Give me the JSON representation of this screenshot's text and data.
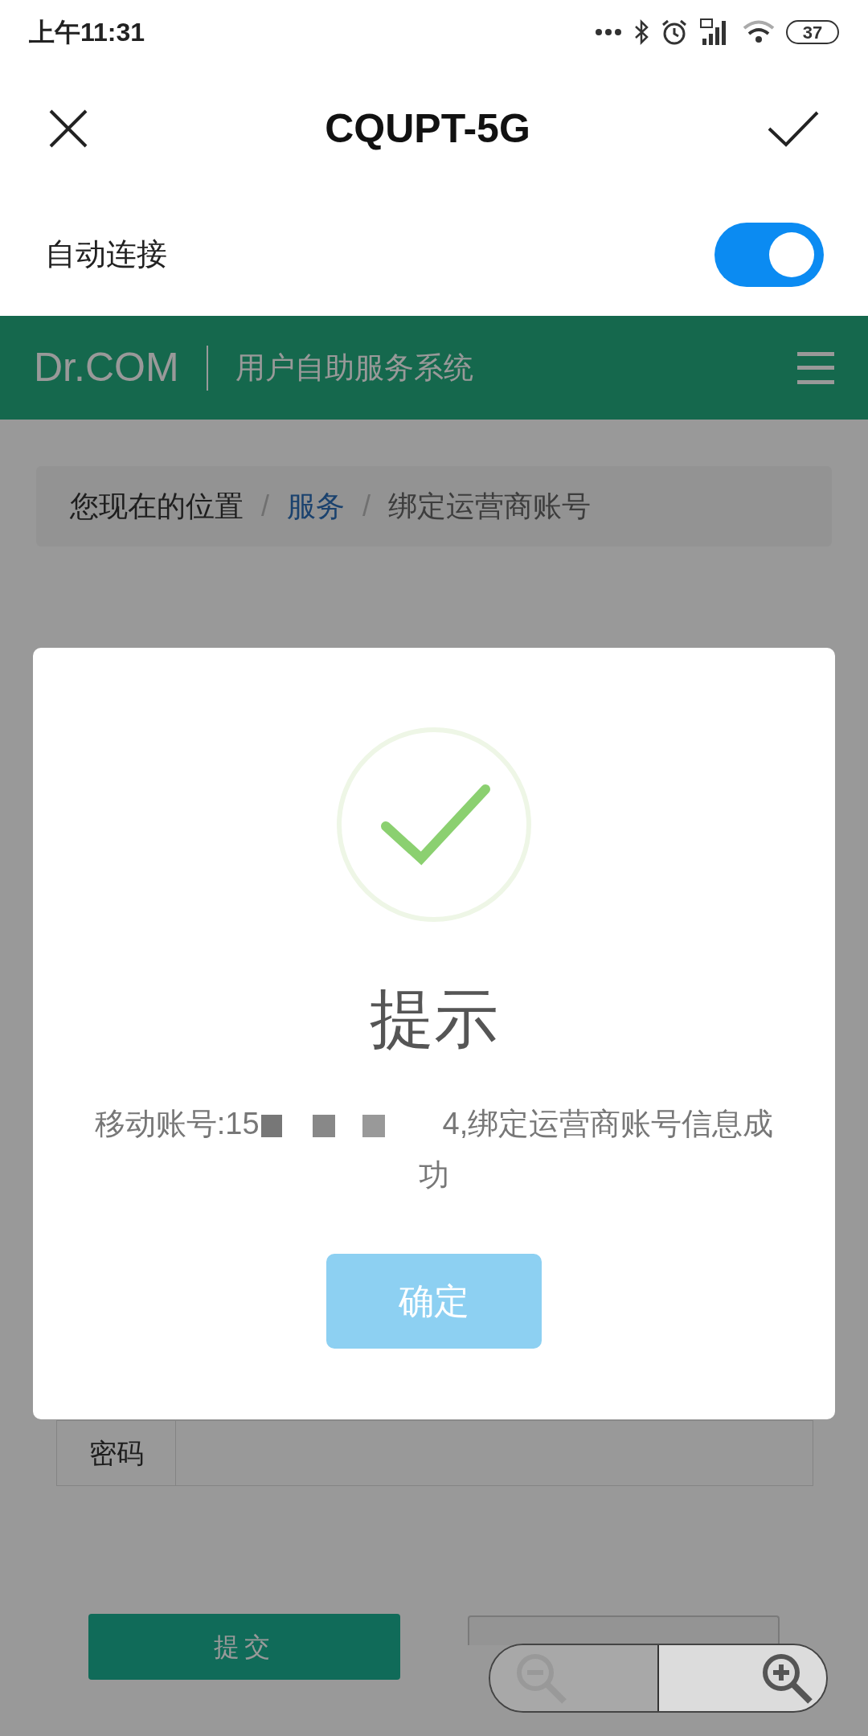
{
  "status_bar": {
    "time": "上午11:31",
    "battery": "37"
  },
  "top_bar": {
    "title": "CQUPT-5G"
  },
  "auto_connect": {
    "label": "自动连接",
    "on": true
  },
  "site_header": {
    "brand": "Dr.COM",
    "subtitle": "用户自助服务系统"
  },
  "breadcrumb": [
    {
      "label": "您现在的位置",
      "kind": "text"
    },
    {
      "label": "/",
      "kind": "separator"
    },
    {
      "label": "服务",
      "kind": "link"
    },
    {
      "label": "/",
      "kind": "separator"
    },
    {
      "label": "绑定运营商账号",
      "kind": "current"
    }
  ],
  "form": {
    "rows": [
      {
        "label": "密码"
      }
    ],
    "buttons": [
      {
        "label": "提交",
        "kind": "primary"
      },
      {
        "kind": "default"
      }
    ]
  },
  "dialog": {
    "title": "提示",
    "message_start": "移动账号:15",
    "message_end": "4,绑定运营商账号信息成功",
    "confirm": "确定"
  }
}
